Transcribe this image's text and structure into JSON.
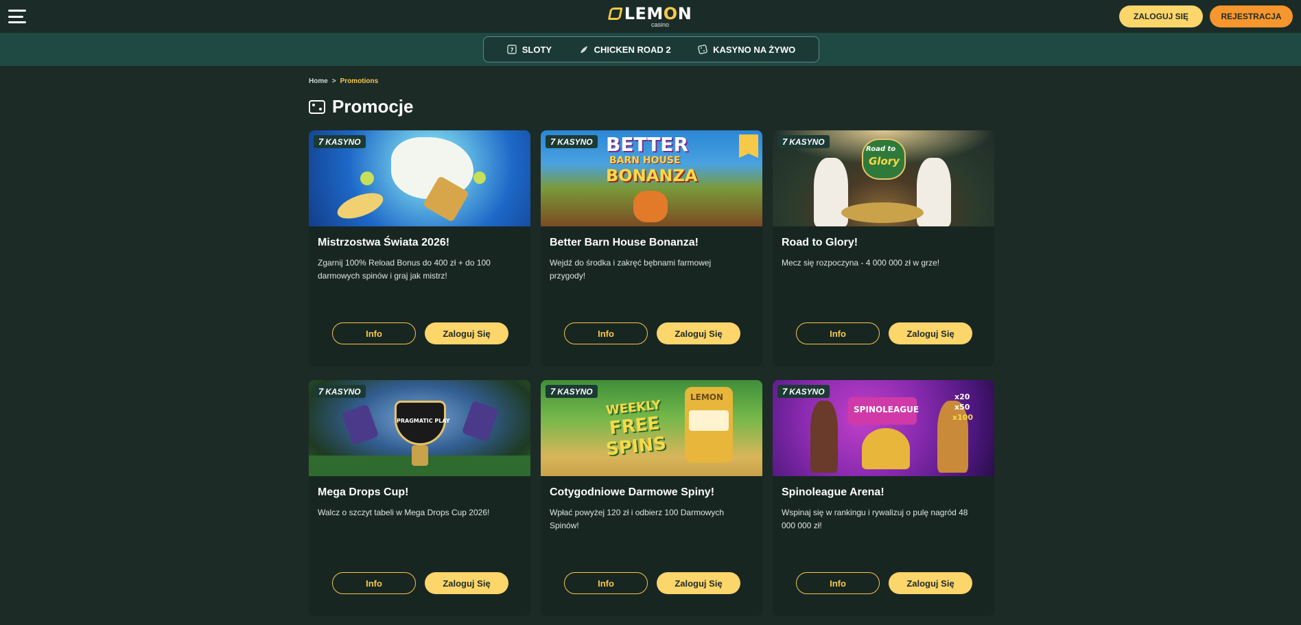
{
  "header": {
    "logo_text_pre": "LEM",
    "logo_text_o": "O",
    "logo_text_post": "N",
    "logo_sub": "casino",
    "login_label": "ZALOGUJ SIĘ",
    "register_label": "REJESTRACJA"
  },
  "nav": {
    "items": [
      {
        "label": "SLOTY",
        "icon": "slot-icon"
      },
      {
        "label": "CHICKEN ROAD 2",
        "icon": "chicken-icon"
      },
      {
        "label": "KASYNO NA ŻYWO",
        "icon": "dice-icon"
      }
    ]
  },
  "breadcrumb": {
    "home": "Home",
    "separator": ">",
    "current": "Promotions"
  },
  "page": {
    "title": "Promocje"
  },
  "badge_label": "KASYNO",
  "badge_seven": "7",
  "cards": [
    {
      "title": "Mistrzostwa Świata 2026!",
      "desc": "Zgarnij 100% Reload Bonus do 400 zł + do 100 darmowych spinów i graj jak mistrz!",
      "info": "Info",
      "login": "Zaloguj Się"
    },
    {
      "title": "Better Barn House Bonanza!",
      "desc": "Wejdź do środka i zakręć bębnami farmowej przygody!",
      "info": "Info",
      "login": "Zaloguj Się",
      "art_text_1": "BETTER",
      "art_text_2": "BARN HOUSE",
      "art_text_3": "BONANZA"
    },
    {
      "title": "Road to Glory!",
      "desc": "Mecz się rozpoczyna - 4 000 000 zł w grze!",
      "info": "Info",
      "login": "Zaloguj Się",
      "art_text_1": "Road to",
      "art_text_2": "Glory"
    },
    {
      "title": "Mega Drops Cup!",
      "desc": "Walcz o szczyt tabeli w Mega Drops Cup 2026!",
      "info": "Info",
      "login": "Zaloguj Się",
      "art_text_1": "PRAGMATIC PLAY"
    },
    {
      "title": "Cotygodniowe Darmowe Spiny!",
      "desc": "Wpłać powyżej 120 zł i odbierz 100 Darmowych Spinów!",
      "info": "Info",
      "login": "Zaloguj Się",
      "art_text_1": "WEEKLY",
      "art_text_2": "FREE",
      "art_text_3": "SPINS",
      "art_text_4": "LEMON"
    },
    {
      "title": "Spinoleague Arena!",
      "desc": "Wspinaj się w rankingu i rywalizuj o pulę nagród 48 000 000 zł!",
      "info": "Info",
      "login": "Zaloguj Się",
      "art_text_1": "SPINOLEAGUE",
      "art_text_2": "x20",
      "art_text_3": "x50",
      "art_text_4": "x100"
    }
  ]
}
